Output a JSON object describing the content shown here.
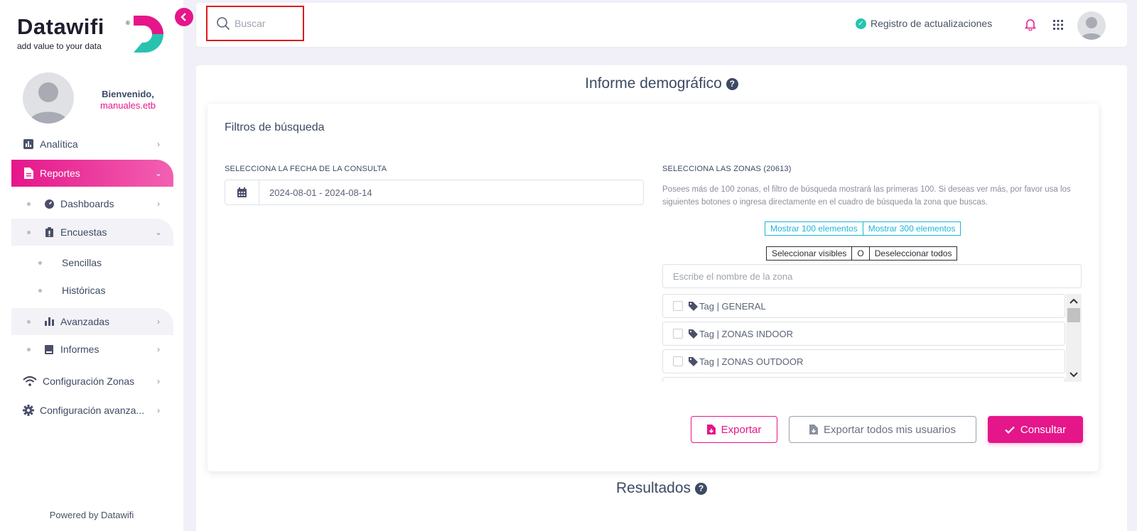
{
  "brand": {
    "name": "Datawifi",
    "registered": "®",
    "tagline": "add value to your data",
    "colors": {
      "primary": "#e5168a",
      "secondary": "#27c3ae"
    }
  },
  "user": {
    "greeting": "Bienvenido,",
    "username": "manuales.etb"
  },
  "sidebar": {
    "items": [
      {
        "label": "Analítica",
        "icon": "bar-chart-icon"
      },
      {
        "label": "Reportes",
        "icon": "document-icon"
      },
      {
        "label": "Dashboards",
        "icon": "gauge-icon"
      },
      {
        "label": "Encuestas",
        "icon": "clipboard-icon"
      },
      {
        "label": "Sencillas"
      },
      {
        "label": "Históricas"
      },
      {
        "label": "Avanzadas",
        "icon": "bar-chart-icon"
      },
      {
        "label": "Informes",
        "icon": "book-icon"
      },
      {
        "label": "Configuración Zonas",
        "icon": "wifi-icon"
      },
      {
        "label": "Configuración avanza...",
        "icon": "gear-icon"
      }
    ],
    "powered_by": "Powered by Datawifi"
  },
  "topbar": {
    "search_placeholder": "Buscar",
    "updates_label": "Registro de actualizaciones"
  },
  "main": {
    "title": "Informe demográfico",
    "filters": {
      "title": "Filtros de búsqueda",
      "date_label": "SELECCIONA LA FECHA DE LA CONSULTA",
      "date_value": "2024-08-01 - 2024-08-14",
      "zones_label": "SELECCIONA LAS ZONAS (20613)",
      "zones_help": "Posees más de 100 zonas, el filtro de búsqueda mostrará las primeras 100. Si deseas ver más, por favor usa los siguientes botones o ingresa directamente en el cuadro de búsqueda la zona que buscas.",
      "show_100": "Mostrar 100 elementos",
      "show_300": "Mostrar 300 elementos",
      "select_visible": "Seleccionar visibles",
      "or": "O",
      "deselect_all": "Deseleccionar todos",
      "zone_search_placeholder": "Escribe el nombre de la zona",
      "zones": [
        "Tag | GENERAL",
        "Tag | ZONAS INDOOR",
        "Tag | ZONAS OUTDOOR"
      ]
    },
    "actions": {
      "export": "Exportar",
      "export_all": "Exportar todos mis usuarios",
      "consult": "Consultar"
    },
    "results_title": "Resultados"
  }
}
